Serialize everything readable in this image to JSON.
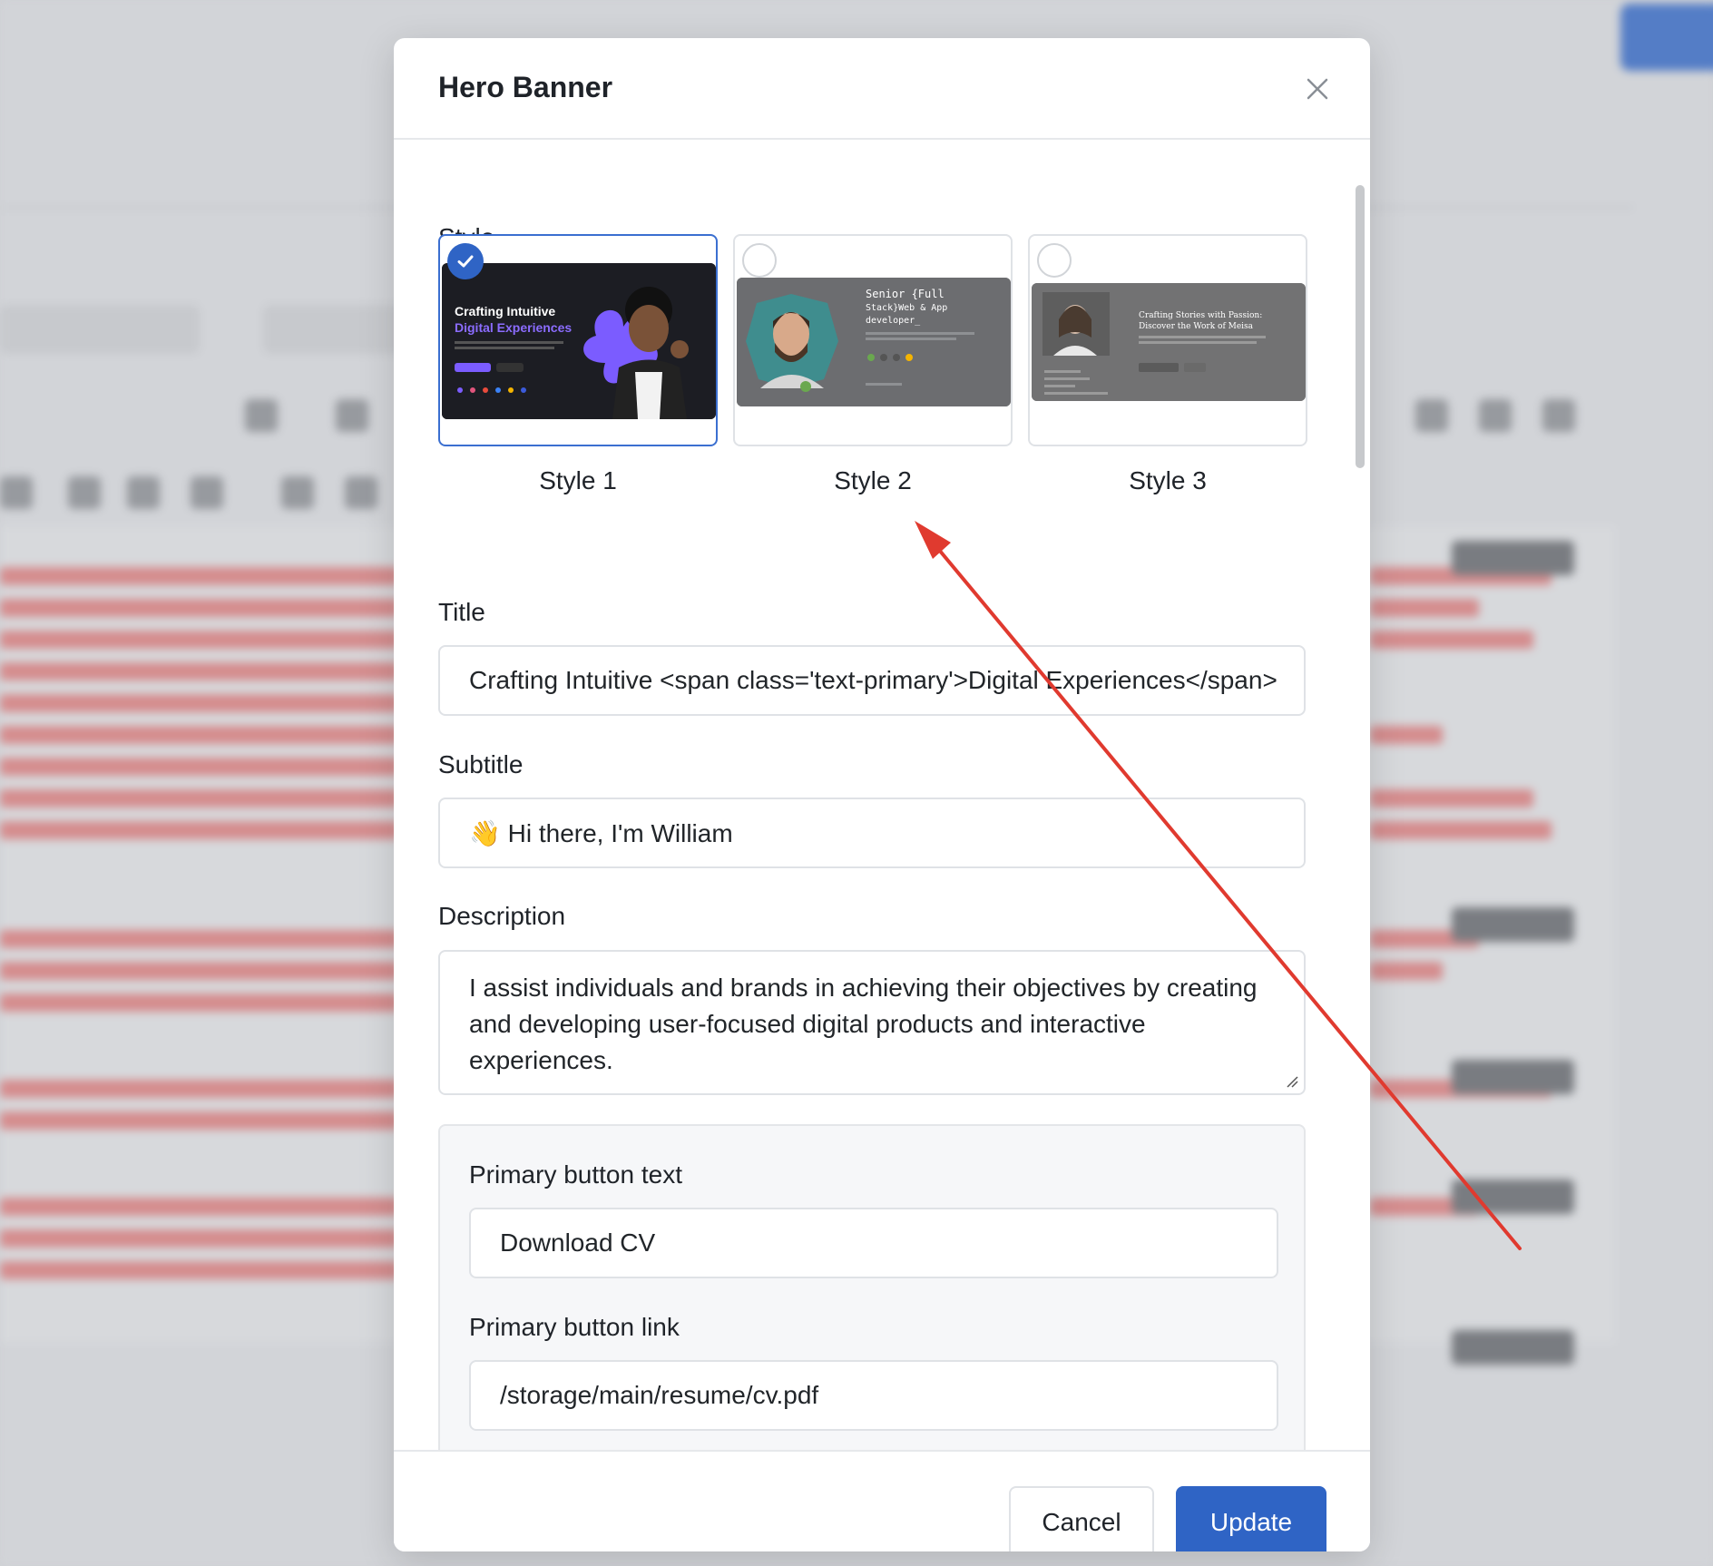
{
  "modal": {
    "title": "Hero Banner",
    "style_label": "Style",
    "styles": [
      {
        "label": "Style 1",
        "selected": true
      },
      {
        "label": "Style 2",
        "selected": false
      },
      {
        "label": "Style 3",
        "selected": false
      }
    ],
    "thumbnails": {
      "style1": {
        "heading_line1": "Crafting Intuitive",
        "heading_line2": "Digital Experiences"
      },
      "style2": {
        "heading_line1": "Senior {Full",
        "heading_line2": "Stack}Web & App",
        "heading_line3": "developer_"
      },
      "style3": {
        "heading_line1": "Crafting Stories with Passion:",
        "heading_line2": "Discover the Work of Meisa"
      }
    },
    "title_label": "Title",
    "title_value": "Crafting Intuitive <span class='text-primary'>Digital Experiences</span>",
    "subtitle_label": "Subtitle",
    "subtitle_value": "👋 Hi there, I'm William",
    "description_label": "Description",
    "description_value": "I assist individuals and brands in achieving their objectives by creating and developing user-focused digital products and interactive experiences.",
    "primary_button_text_label": "Primary button text",
    "primary_button_text_value": "Download CV",
    "primary_button_link_label": "Primary button link",
    "primary_button_link_value": "/storage/main/resume/cv.pdf",
    "cancel_label": "Cancel",
    "update_label": "Update"
  },
  "colors": {
    "accent": "#2f64c5",
    "annotation_arrow": "#e03a2f",
    "thumb_purple": "#7b5cff"
  }
}
